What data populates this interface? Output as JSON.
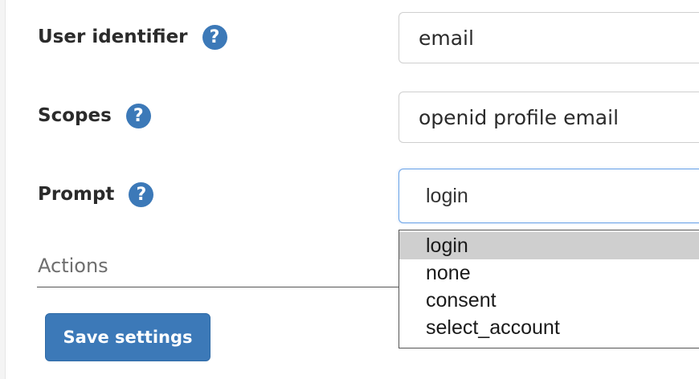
{
  "form": {
    "fields": [
      {
        "label": "User identifier",
        "value": "email"
      },
      {
        "label": "Scopes",
        "value": "openid profile email"
      },
      {
        "label": "Prompt",
        "value": "login"
      }
    ],
    "help_glyph": "?",
    "prompt_dropdown": {
      "options": [
        "login",
        "none",
        "consent",
        "select_account"
      ],
      "highlighted": "login"
    }
  },
  "actions": {
    "heading": "Actions",
    "save_label": "Save settings"
  },
  "colors": {
    "accent": "#3c79b8",
    "focus_border": "#6ea6e8",
    "highlight": "#cfcfcf"
  },
  "icons": {
    "help": "question-circle-icon"
  }
}
